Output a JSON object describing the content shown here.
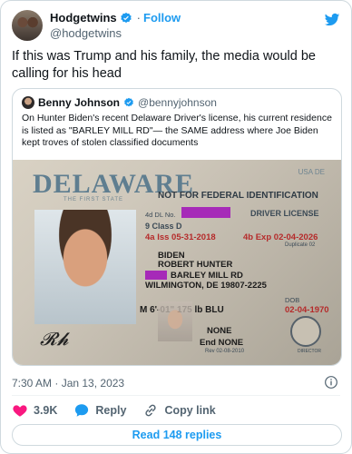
{
  "tweet": {
    "author_name": "Hodgetwins",
    "handle": "@hodgetwins",
    "follow_label": "Follow",
    "text": "If this was Trump and his family, the media would be calling for his head",
    "timestamp": "7:30 AM · Jan 13, 2023"
  },
  "quote": {
    "author_name": "Benny Johnson",
    "handle": "@bennyjohnson",
    "text": "On Hunter Biden's recent Delaware Driver's license, his current residence is listed as \"BARLEY MILL RD\"— the SAME address where Joe Biden kept troves of stolen classified documents"
  },
  "license": {
    "state": "DELAWARE",
    "subtitle": "THE FIRST STATE",
    "usa": "USA DE",
    "not_for_federal": "NOT FOR FEDERAL IDENTIFICATION",
    "driver_license": "DRIVER LICENSE",
    "dl_no_label": "4d DL No.",
    "class": "9 Class D",
    "iss": "4a Iss 05-31-2018",
    "exp": "4b Exp 02-04-2026",
    "duplicate": "Duplicate 02",
    "last_name": "BIDEN",
    "first_name": "ROBERT HUNTER",
    "address1": "BARLEY MILL RD",
    "address2": "WILMINGTON, DE 19807-2225",
    "sex_hgt_wgt_eyes": "M   6'-01\"   175 lb   BLU",
    "dob_label": "DOB",
    "dob": "02-04-1970",
    "restrictions": "NONE",
    "end": "End NONE",
    "rev": "Rev 02-08-2010",
    "director": "DIRECTOR",
    "signature": "R.H."
  },
  "actions": {
    "likes": "3.9K",
    "reply_label": "Reply",
    "copy_link_label": "Copy link",
    "read_replies": "Read 148 replies"
  },
  "colors": {
    "accent": "#1d9bf0",
    "like": "#f91880",
    "redaction": "#a62ab8"
  }
}
